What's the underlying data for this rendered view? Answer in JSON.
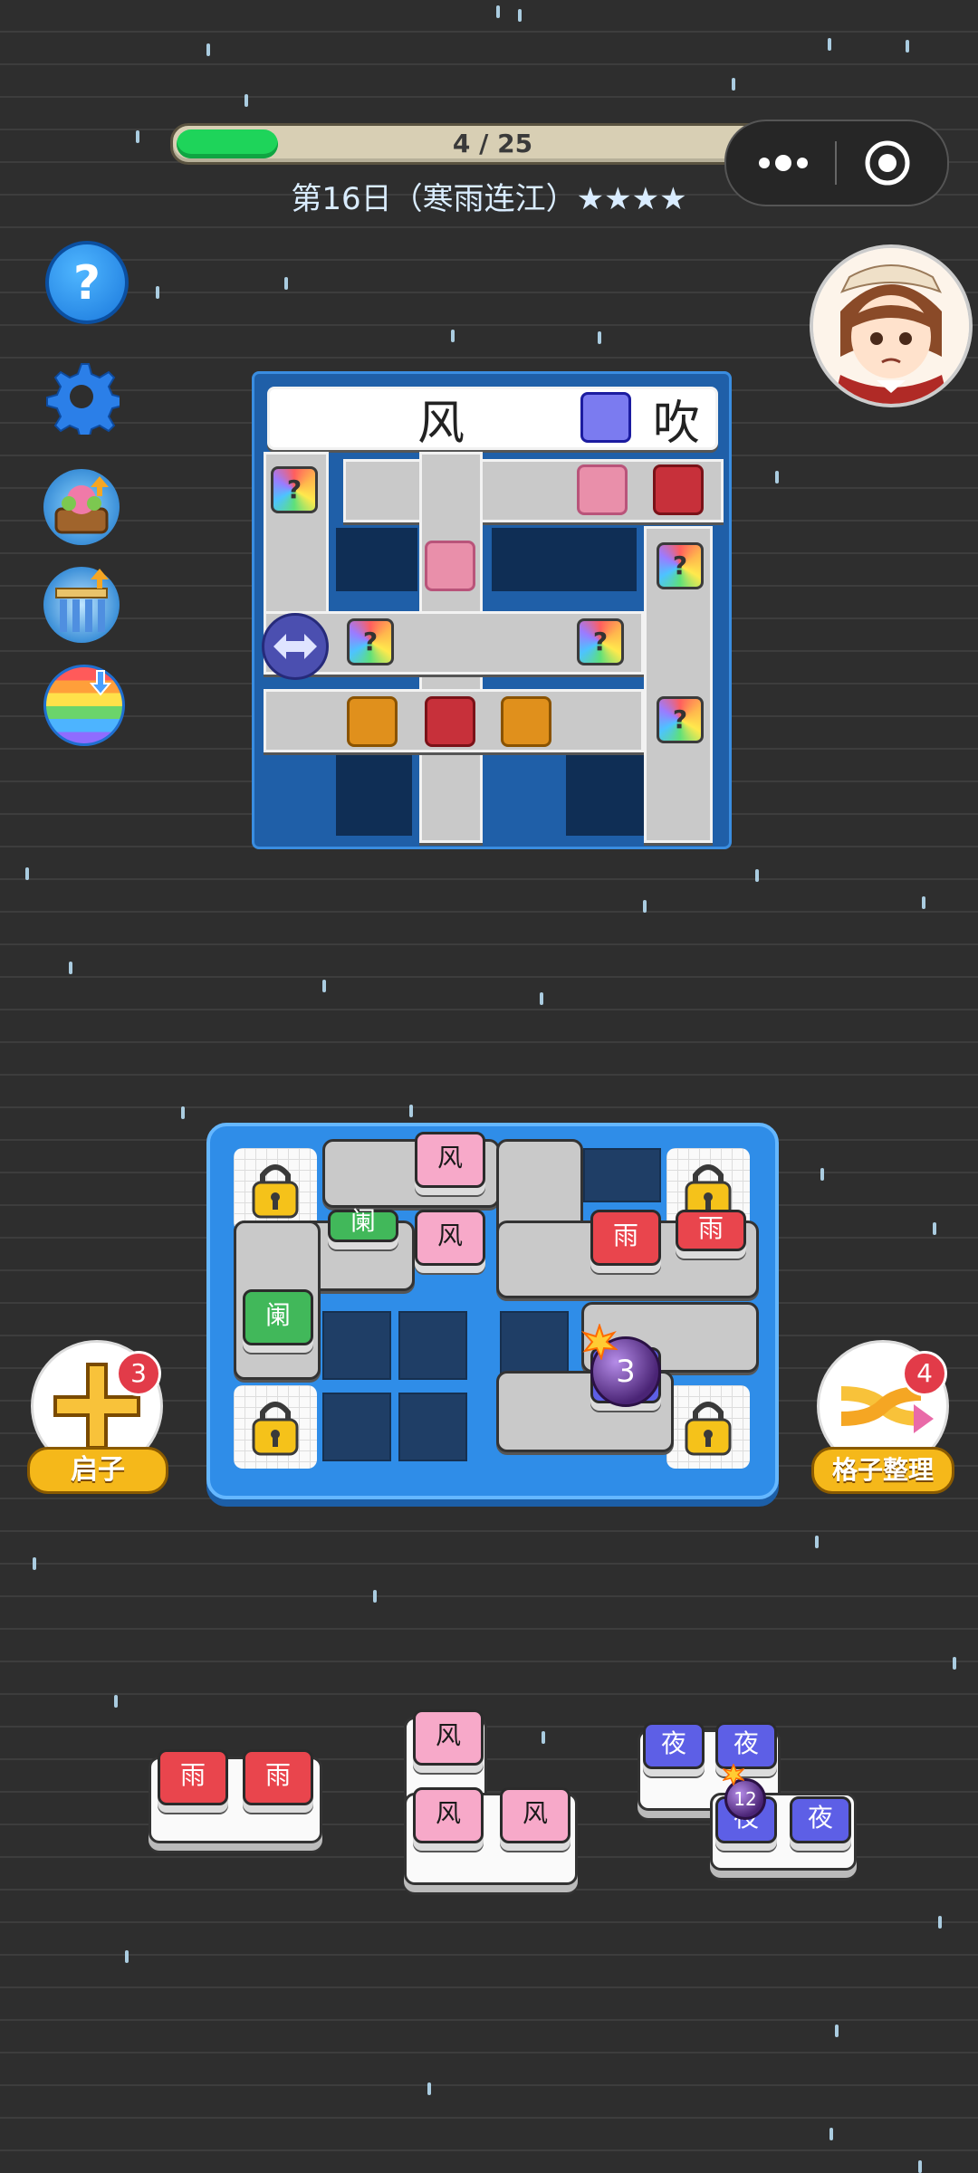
{
  "progress": {
    "text": "4 / 25",
    "current": 4,
    "total": 25
  },
  "level": {
    "title": "第16日（寒雨连江）★★★★"
  },
  "icons": {
    "help": "question-mark-icon",
    "settings": "gear-icon",
    "more": "more-dots-icon",
    "target": "target-circle-icon",
    "flower": "flower-pot-icon",
    "pillar": "pillar-boost-icon",
    "rainbow": "rainbow-icon",
    "avatar": "girl-avatar-icon",
    "lock": "padlock-icon"
  },
  "preview": {
    "word_left": "风",
    "word_right": "吹",
    "question": "?"
  },
  "board": {
    "blocks": {
      "feng1": "风",
      "feng2": "风",
      "yu1": "雨",
      "yu2": "雨",
      "lan1": "阑",
      "lan2": "阑"
    },
    "bomb_count": "3"
  },
  "tools": {
    "left": {
      "label": "启子",
      "badge": "3"
    },
    "right": {
      "label": "格子整理",
      "badge": "4"
    }
  },
  "tray": {
    "piece1": [
      "雨",
      "雨"
    ],
    "piece2": [
      "风",
      "风",
      "风"
    ],
    "piece3": [
      "夜",
      "夜",
      "夜",
      "夜"
    ],
    "piece3_bomb": "12"
  },
  "colors": {
    "pink": "#f7a9c9",
    "red": "#e9454d",
    "green": "#41b85a",
    "blue": "#5d5fe6",
    "board": "#2f8de8",
    "progress": "#1ed45a"
  }
}
